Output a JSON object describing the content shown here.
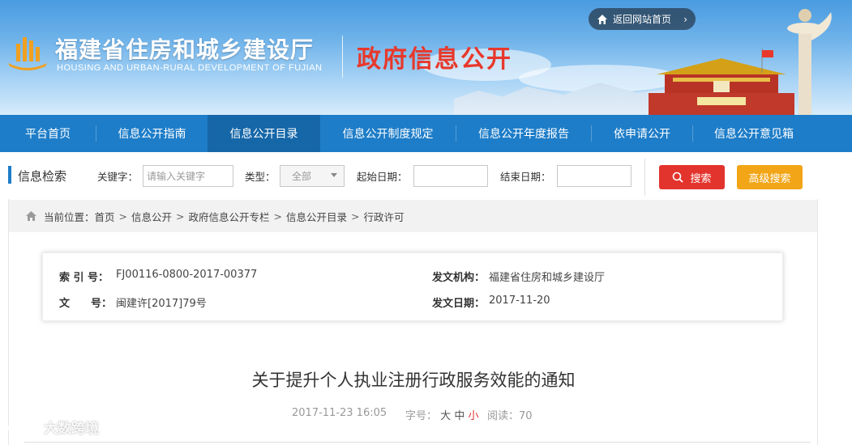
{
  "header": {
    "site_title": "福建省住房和城乡建设厅",
    "site_subtitle": "HOUSING AND URBAN-RURAL DEVELOPMENT OF FUJIAN",
    "section_title": "政府信息公开",
    "return_home": "返回网站首页",
    "return_chevron": "›"
  },
  "nav": {
    "items": [
      {
        "label": "平台首页"
      },
      {
        "label": "信息公开指南"
      },
      {
        "label": "信息公开目录"
      },
      {
        "label": "信息公开制度规定"
      },
      {
        "label": "信息公开年度报告"
      },
      {
        "label": "依申请公开"
      },
      {
        "label": "信息公开意见箱"
      }
    ],
    "active_index": 2
  },
  "search": {
    "title": "信息检索",
    "keyword_label": "关键字：",
    "keyword_placeholder": "请输入关键字",
    "type_label": "类型：",
    "type_selected": "全部",
    "start_label": "起始日期：",
    "end_label": "结束日期：",
    "search_button": "搜索",
    "advanced_button": "高级搜索"
  },
  "breadcrumb": {
    "prefix": "当前位置：",
    "items": [
      "首页",
      "信息公开",
      "政府信息公开专栏",
      "信息公开目录",
      "行政许可"
    ],
    "separator": ">"
  },
  "meta": {
    "index_label": "索 引 号：",
    "index_value": "FJ00116-0800-2017-00377",
    "org_label": "发文机构：",
    "org_value": "福建省住房和城乡建设厅",
    "doc_label": "文　　号：",
    "doc_value": "闽建许[2017]79号",
    "date_label": "发文日期：",
    "date_value": "2017-11-20"
  },
  "article": {
    "title": "关于提升个人执业注册行政服务效能的通知",
    "published": "2017-11-23 16:05",
    "font_size_label": "字号：",
    "font_large": "大",
    "font_medium": "中",
    "font_small": "小",
    "reads_label": "阅读：",
    "reads_value": "70"
  },
  "watermark": {
    "text": "大数跨境"
  },
  "colors": {
    "nav_bg": "#1e7dc8",
    "nav_active": "#1667a8",
    "search_button": "#e3332d",
    "advanced_button": "#f2a516",
    "section_title": "#e8382b"
  }
}
